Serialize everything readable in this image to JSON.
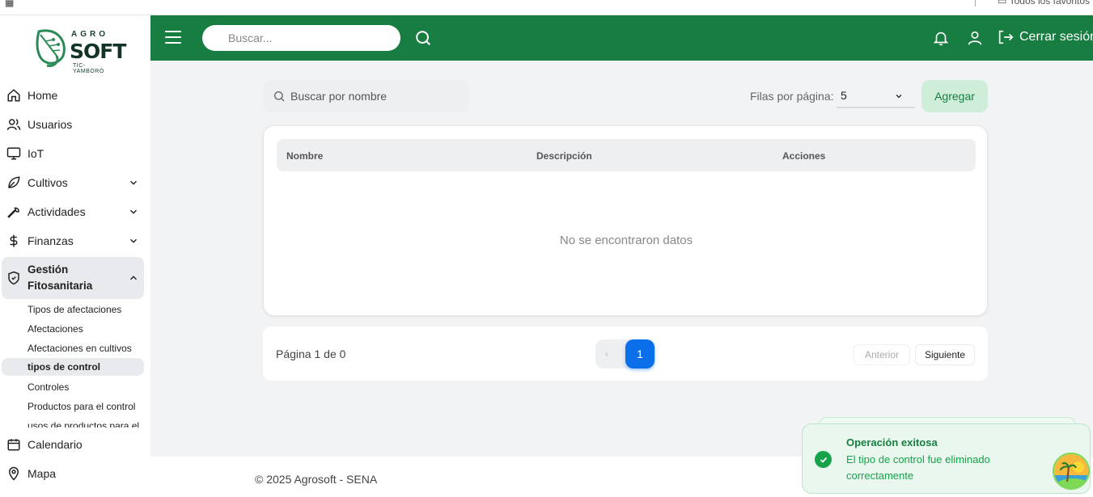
{
  "browser": {
    "favorites_label": "Todos los favoritos"
  },
  "logo": {
    "agro": "AGRO",
    "soft": "SOFT",
    "tagline": "TIC-YAMBORÓ"
  },
  "sidebar": {
    "items": [
      {
        "label": "Home",
        "icon": "home-icon"
      },
      {
        "label": "Usuarios",
        "icon": "users-icon"
      },
      {
        "label": "IoT",
        "icon": "monitor-icon"
      },
      {
        "label": "Cultivos",
        "icon": "leaf-icon"
      },
      {
        "label": "Actividades",
        "icon": "wrench-icon"
      },
      {
        "label": "Finanzas",
        "icon": "dollar-icon"
      },
      {
        "label": "Gestión Fitosanitaria",
        "icon": "shield-icon"
      },
      {
        "label": "Calendario",
        "icon": "calendar-icon"
      },
      {
        "label": "Mapa",
        "icon": "map-pin-icon"
      }
    ],
    "sub_items": [
      {
        "label": "Tipos de afectaciones"
      },
      {
        "label": "Afectaciones"
      },
      {
        "label": "Afectaciones en cultivos"
      },
      {
        "label": "tipos de control"
      },
      {
        "label": "Controles"
      },
      {
        "label": "Productos para el control"
      },
      {
        "label": "usos de productos para el"
      }
    ]
  },
  "header": {
    "search_placeholder": "Buscar...",
    "logout_label": "Cerrar sesión"
  },
  "toolbar": {
    "search_placeholder": "Buscar por nombre",
    "rows_label": "Filas por página:",
    "rows_value": "5",
    "add_label": "Agregar"
  },
  "table": {
    "columns": [
      "Nombre",
      "Descripción",
      "Acciones"
    ],
    "empty_message": "No se encontraron datos"
  },
  "pagination": {
    "info": "Página 1 de 0",
    "prev_icon": "‹",
    "current_page": "1",
    "prev_label": "Anterior",
    "next_label": "Siguiente"
  },
  "footer": {
    "copyright": "© 2025 Agrosoft - SENA"
  },
  "toast": {
    "title": "Operación exitosa",
    "message": "El tipo de control fue eliminado correctamente"
  },
  "colors": {
    "header_green": "#177d40",
    "accent_blue": "#0a6fe8",
    "success_green": "#16a34a"
  }
}
